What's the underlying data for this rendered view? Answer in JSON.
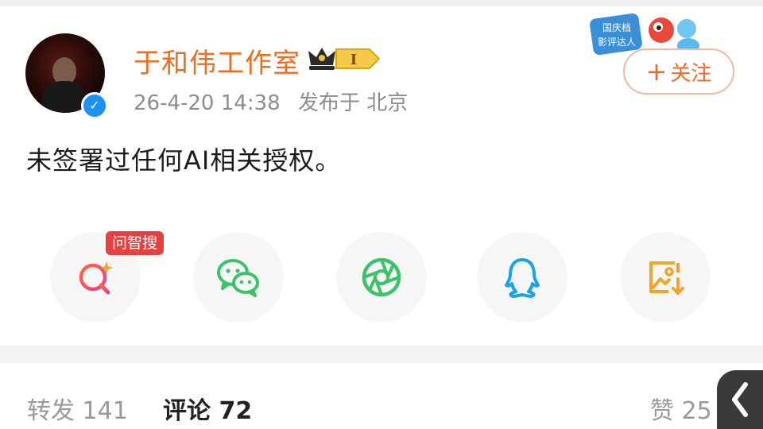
{
  "header": {
    "username": "于和伟工作室",
    "vip_level": "I",
    "date": "26-4-20 14:38",
    "location": "发布于 北京",
    "follow_label": "关注",
    "event_badge_line1": "国庆档",
    "event_badge_line2": "影评达人"
  },
  "post": {
    "text": "未签署过任何AI相关授权。"
  },
  "share": {
    "ai_tag": "问智搜",
    "items": [
      "ai-search",
      "wechat",
      "moments",
      "qq",
      "save-image"
    ]
  },
  "tabs": {
    "repost_label": "转发",
    "repost_count": "141",
    "comment_label": "评论",
    "comment_count": "72",
    "like_label": "赞",
    "like_count": "25"
  },
  "colors": {
    "username": "#f26b1d",
    "follow": "#ef6a28",
    "tag": "#e54141",
    "wechat": "#3cc36a",
    "qq": "#19a4e8",
    "save": "#f0a52a"
  }
}
